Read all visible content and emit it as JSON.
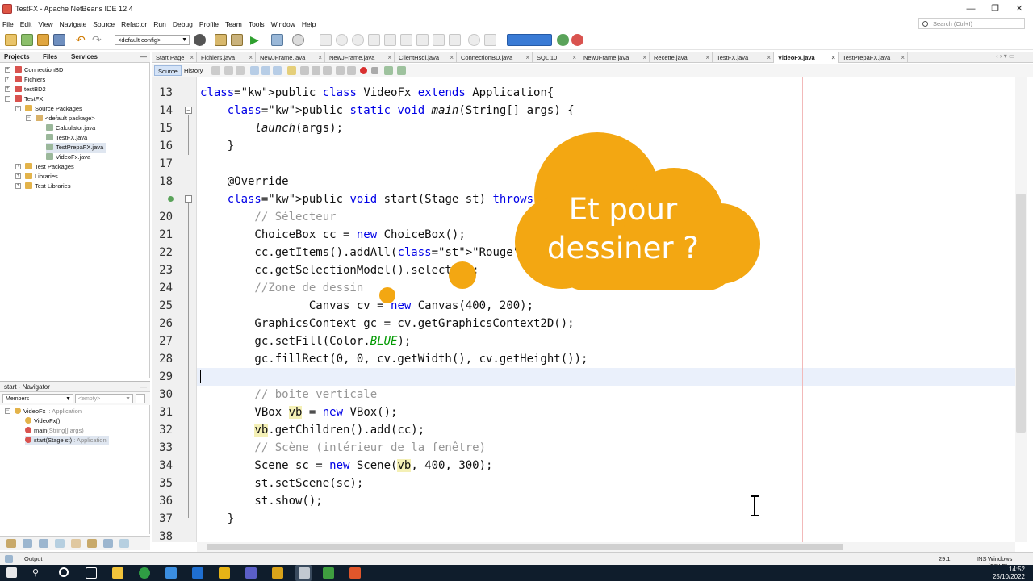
{
  "window": {
    "title": "TestFX - Apache NetBeans IDE 12.4"
  },
  "menu": [
    "File",
    "Edit",
    "View",
    "Navigate",
    "Source",
    "Refactor",
    "Run",
    "Debug",
    "Profile",
    "Team",
    "Tools",
    "Window",
    "Help"
  ],
  "search": {
    "placeholder": "Search (Ctrl+I)"
  },
  "toolbar": {
    "config": "<default config>"
  },
  "projects_panel": {
    "tabs": [
      "Projects",
      "Files",
      "Services"
    ],
    "tree": [
      {
        "label": "ConnectionBD",
        "depth": 0,
        "icon": "project-icon"
      },
      {
        "label": "Fichiers",
        "depth": 0,
        "icon": "project-icon"
      },
      {
        "label": "testBD2",
        "depth": 0,
        "icon": "project-icon"
      },
      {
        "label": "TestFX",
        "depth": 0,
        "icon": "project-icon"
      },
      {
        "label": "Source Packages",
        "depth": 1,
        "icon": "folder-icon"
      },
      {
        "label": "<default package>",
        "depth": 2,
        "icon": "package-icon"
      },
      {
        "label": "Calculator.java",
        "depth": 3,
        "icon": "java-file-icon"
      },
      {
        "label": "TestFX.java",
        "depth": 3,
        "icon": "java-file-icon"
      },
      {
        "label": "TestPrepaFX.java",
        "depth": 3,
        "icon": "java-file-icon",
        "selected": true
      },
      {
        "label": "VideoFx.java",
        "depth": 3,
        "icon": "java-file-icon"
      },
      {
        "label": "Test Packages",
        "depth": 1,
        "icon": "folder-icon"
      },
      {
        "label": "Libraries",
        "depth": 1,
        "icon": "folder-icon"
      },
      {
        "label": "Test Libraries",
        "depth": 1,
        "icon": "folder-icon"
      }
    ]
  },
  "navigator": {
    "title": "start - Navigator",
    "members_select": "Members",
    "filter_select": "<empty>",
    "tree": [
      {
        "label": "VideoFx",
        "suffix": " :: Application",
        "depth": 0
      },
      {
        "label": "VideoFx()",
        "suffix": "",
        "depth": 1
      },
      {
        "label": "main",
        "suffix": "(String[] args)",
        "depth": 1
      },
      {
        "label": "start(Stage st)",
        "suffix": " : Application",
        "depth": 1,
        "selected": true
      }
    ]
  },
  "editor": {
    "tabs": [
      "Start Page",
      "Fichiers.java",
      "NewJFrame.java",
      "NewJFrame.java",
      "ClientHsql.java",
      "ConnectionBD.java",
      "SQL 10",
      "NewJFrame.java",
      "Recette.java",
      "TestFX.java",
      "VideoFx.java",
      "TestPrepaFX.java"
    ],
    "active_tab": "VideoFx.java",
    "source_label": "Source",
    "history_label": "History",
    "lines": [
      {
        "n": "13",
        "text": "public class VideoFx extends Application{"
      },
      {
        "n": "14",
        "text": "    public static void main(String[] args) {"
      },
      {
        "n": "15",
        "text": "        launch(args);"
      },
      {
        "n": "16",
        "text": "    }"
      },
      {
        "n": "17",
        "text": ""
      },
      {
        "n": "18",
        "text": "    @Override"
      },
      {
        "n": "",
        "text": "    public void start(Stage st) throws Exception"
      },
      {
        "n": "20",
        "text": "        // Sélecteur"
      },
      {
        "n": "21",
        "text": "        ChoiceBox cc = new ChoiceBox();"
      },
      {
        "n": "22",
        "text": "        cc.getItems().addAll(\"Rouge\",\"Vert\""
      },
      {
        "n": "23",
        "text": "        cc.getSelectionModel().select(0);"
      },
      {
        "n": "24",
        "text": "        //Zone de dessin"
      },
      {
        "n": "25",
        "text": "                Canvas cv = new Canvas(400, 200);"
      },
      {
        "n": "26",
        "text": "        GraphicsContext gc = cv.getGraphicsContext2D();"
      },
      {
        "n": "27",
        "text": "        gc.setFill(Color.BLUE);"
      },
      {
        "n": "28",
        "text": "        gc.fillRect(0, 0, cv.getWidth(), cv.getHeight());"
      },
      {
        "n": "29",
        "text": ""
      },
      {
        "n": "30",
        "text": "        // boite verticale"
      },
      {
        "n": "31",
        "text": "        VBox vb = new VBox();"
      },
      {
        "n": "32",
        "text": "        vb.getChildren().add(cc);"
      },
      {
        "n": "33",
        "text": "        // Scène (intérieur de la fenêtre)"
      },
      {
        "n": "34",
        "text": "        Scene sc = new Scene(vb, 400, 300);"
      },
      {
        "n": "35",
        "text": "        st.setScene(sc);"
      },
      {
        "n": "36",
        "text": "        st.show();"
      },
      {
        "n": "37",
        "text": "    }"
      },
      {
        "n": "38",
        "text": ""
      }
    ]
  },
  "overlay": {
    "line1": "Et pour",
    "line2": "dessiner ?",
    "color": "#f3a712"
  },
  "status": {
    "output": "Output",
    "position": "29:1",
    "mode": "INS",
    "eol": "Windows (CRLF)"
  },
  "taskbar": {
    "time": "14:52",
    "date": "25/10/2022"
  }
}
